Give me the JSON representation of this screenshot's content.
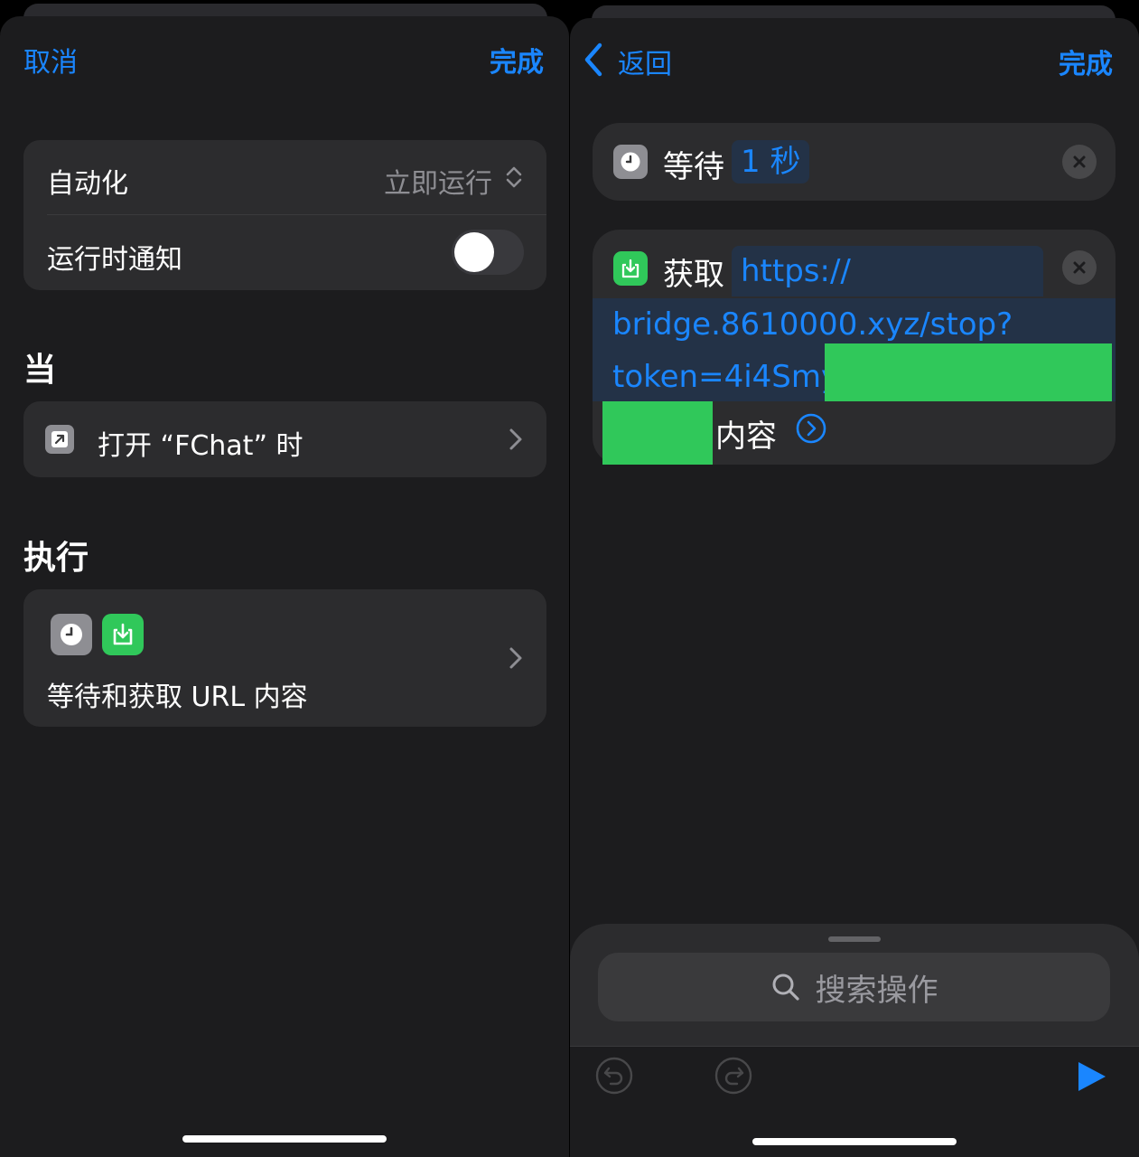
{
  "left": {
    "nav": {
      "cancel": "取消",
      "done": "完成"
    },
    "settings": {
      "automation_label": "自动化",
      "automation_value": "立即运行",
      "notify_label": "运行时通知",
      "notify_on": false
    },
    "when_title": "当",
    "trigger": {
      "icon": "open-app-arrow-icon",
      "label": "打开 “FChat” 时"
    },
    "do_title": "执行",
    "actions_summary": {
      "icons": [
        "clock-icon",
        "download-icon"
      ],
      "label": "等待和获取 URL 内容"
    }
  },
  "right": {
    "nav": {
      "back": "返回",
      "done": "完成"
    },
    "wait_action": {
      "label": "等待",
      "token": "1 秒"
    },
    "fetch_action": {
      "label": "获取",
      "url_line1": "https://",
      "url_line2": "bridge.8610000.xyz/stop?",
      "url_line3": "token=4i4Smy",
      "suffix": "内容"
    },
    "search": {
      "placeholder": "搜索操作"
    }
  },
  "colors": {
    "accent": "#1a86ff",
    "panel": "#1c1c1e",
    "card": "#2c2c2e",
    "redaction": "#30c85a",
    "download_icon_bg": "#30c85a",
    "clock_icon_bg": "#8e8e93"
  }
}
